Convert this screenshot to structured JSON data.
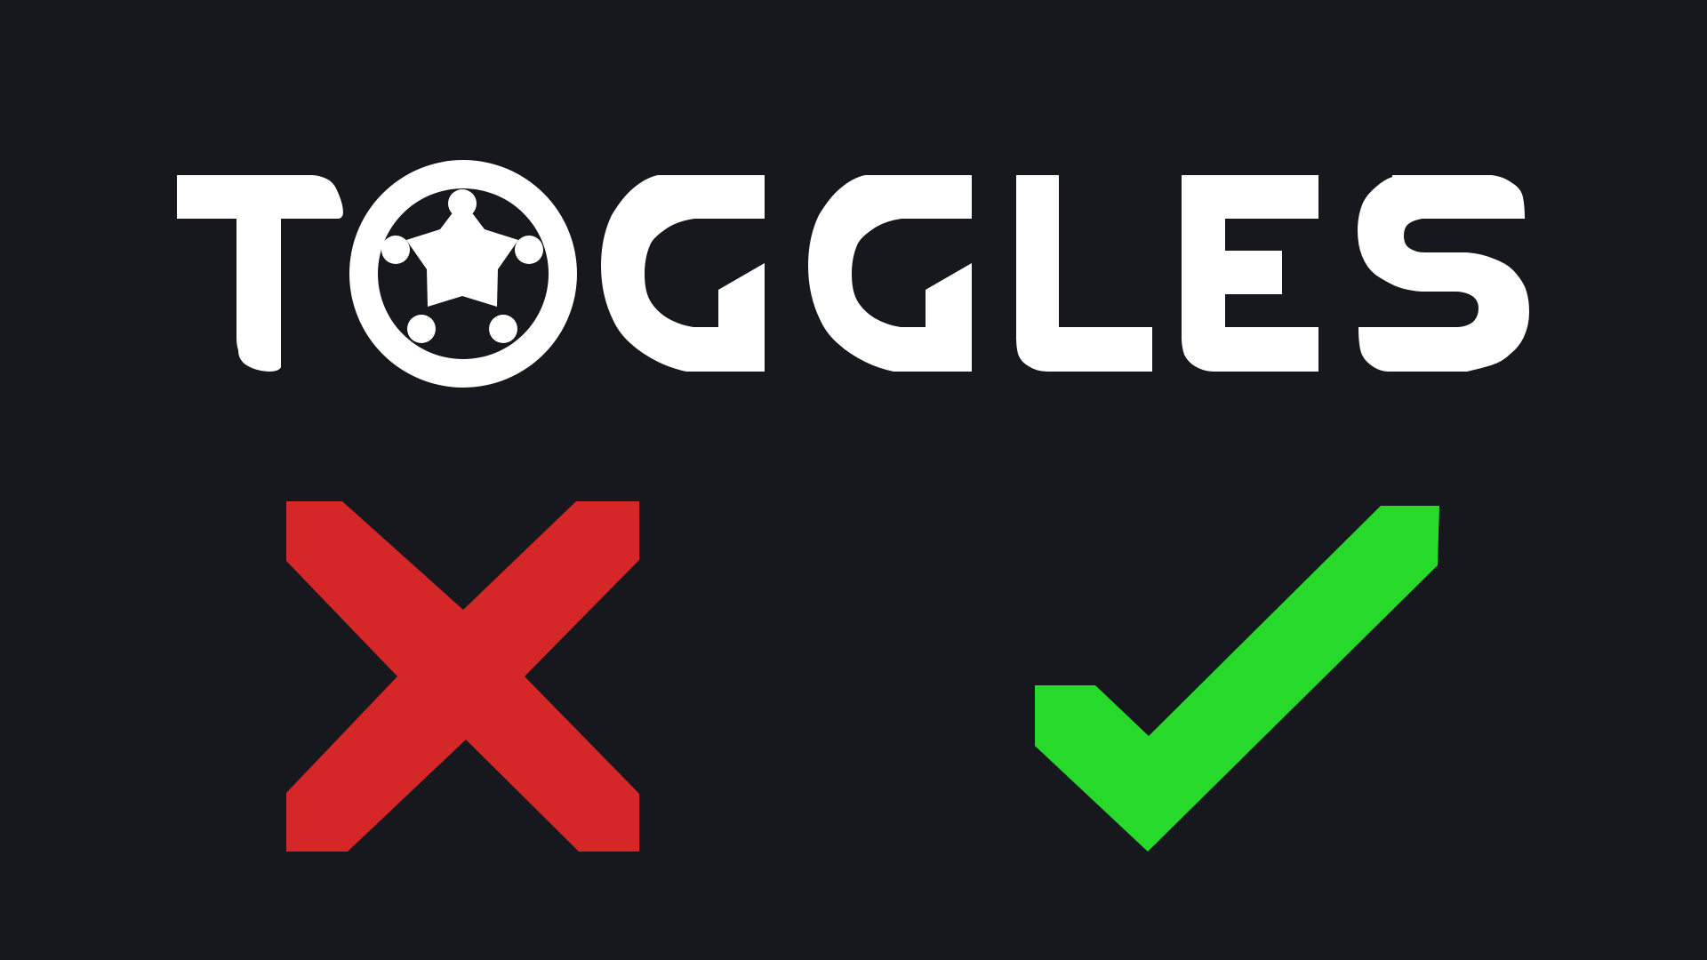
{
  "title": {
    "text": "TOGGLES",
    "color": "#ffffff"
  },
  "background_color": "#16181d",
  "badge_icon": "sheriff-star-badge",
  "toggles": [
    {
      "name": "off",
      "icon": "x-cross-icon",
      "color": "#d62728"
    },
    {
      "name": "on",
      "icon": "checkmark-icon",
      "color": "#27d92b"
    }
  ]
}
